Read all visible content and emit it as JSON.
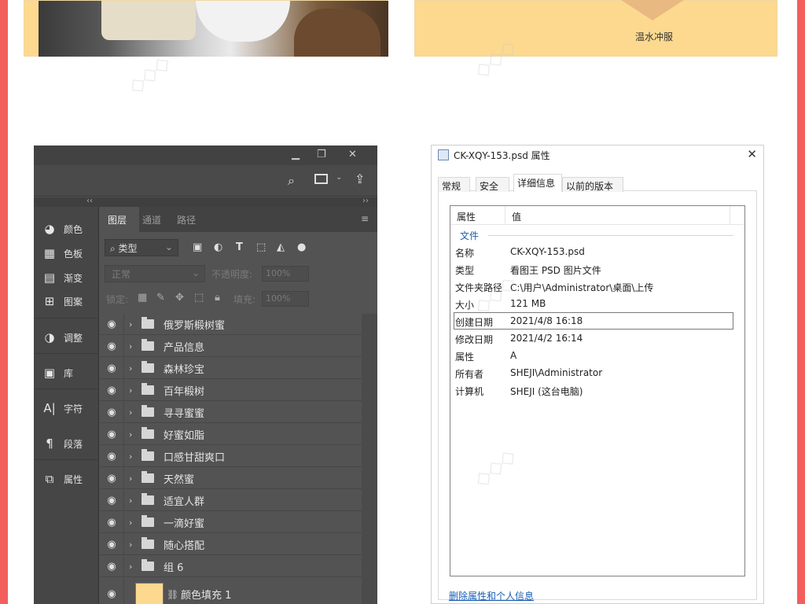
{
  "top_cards": {
    "right_caption": "温水冲服"
  },
  "photoshop": {
    "tabs": [
      "图层",
      "通道",
      "路径"
    ],
    "dock_items": [
      {
        "icon": "palette-icon",
        "label": "颜色"
      },
      {
        "icon": "swatches-icon",
        "label": "色板"
      },
      {
        "icon": "gradient-icon",
        "label": "渐变"
      },
      {
        "icon": "pattern-icon",
        "label": "图案"
      },
      {
        "icon": "adjust-icon",
        "label": "调整"
      },
      {
        "icon": "library-icon",
        "label": "库"
      },
      {
        "icon": "character-icon",
        "label": "字符"
      },
      {
        "icon": "paragraph-icon",
        "label": "段落"
      },
      {
        "icon": "properties-icon",
        "label": "属性"
      }
    ],
    "filter_kind": "类型",
    "blend_mode": "正常",
    "opacity_label": "不透明度:",
    "opacity_value": "100%",
    "lock_label": "锁定:",
    "fill_label": "填充:",
    "fill_value": "100%",
    "layers": [
      "俄罗斯椴树蜜",
      "产品信息",
      "森林珍宝",
      "百年椴树",
      "寻寻蜜蜜",
      "好蜜如脂",
      "口感甘甜爽口",
      "天然蜜",
      "适宜人群",
      "一滴好蜜",
      "随心搭配",
      "组 6"
    ],
    "fill_layer_name": "颜色填充  1",
    "accent_fill": "#fcd98f"
  },
  "dialog": {
    "title": "CK-XQY-153.psd 属性",
    "tabs": [
      "常规",
      "安全",
      "详细信息",
      "以前的版本"
    ],
    "col_property": "属性",
    "col_value": "值",
    "group": "文件",
    "rows": [
      {
        "k": "名称",
        "v": "CK-XQY-153.psd"
      },
      {
        "k": "类型",
        "v": "看图王 PSD 图片文件"
      },
      {
        "k": "文件夹路径",
        "v": "C:\\用户\\Administrator\\桌面\\上传"
      },
      {
        "k": "大小",
        "v": "121 MB"
      },
      {
        "k": "创建日期",
        "v": "2021/4/8 16:18"
      },
      {
        "k": "修改日期",
        "v": "2021/4/2 16:14"
      },
      {
        "k": "属性",
        "v": "A"
      },
      {
        "k": "所有者",
        "v": "SHEJI\\Administrator"
      },
      {
        "k": "计算机",
        "v": "SHEJI (这台电脑)"
      }
    ],
    "remove_link": "删除属性和个人信息"
  }
}
